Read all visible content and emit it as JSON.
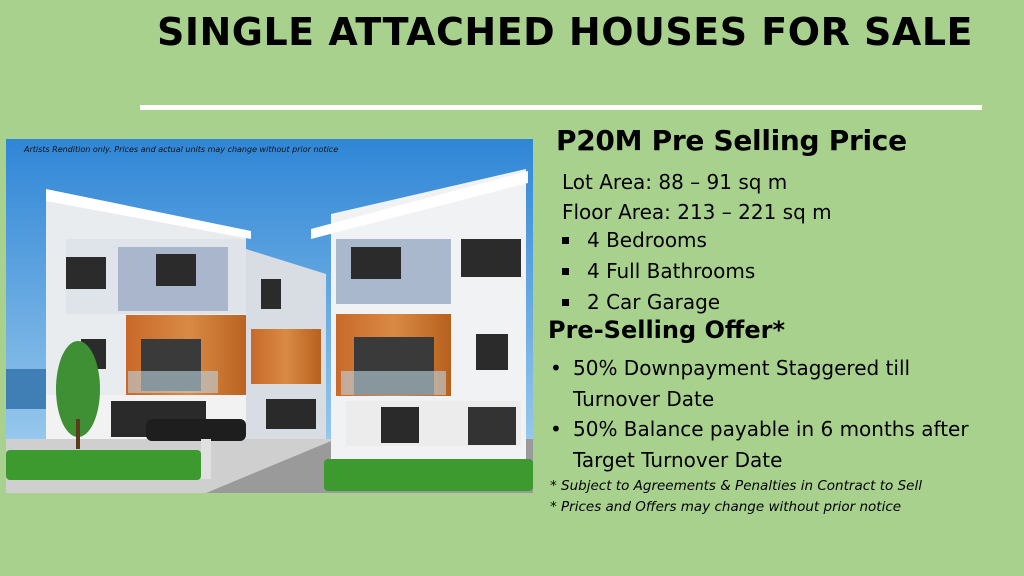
{
  "title": "SINGLE ATTACHED HOUSES FOR SALE",
  "image": {
    "disclaimer": "Artists Rendition only. Prices and actual units may change without prior notice"
  },
  "listing": {
    "price": "P20M  Pre Selling Price",
    "lot_area": "Lot Area: 88 – 91 sq m",
    "floor_area": "Floor Area: 213 – 221 sq m",
    "features": [
      "4 Bedrooms",
      "4 Full Bathrooms",
      "2 Car Garage"
    ]
  },
  "offer": {
    "heading": "Pre-Selling Offer*",
    "bullets": [
      {
        "line1": "50% Downpayment Staggered till",
        "line2": "Turnover Date"
      },
      {
        "line1": "50% Balance payable in 6 months after",
        "line2": "Target Turnover Date"
      }
    ],
    "notes": [
      "* Subject to Agreements & Penalties in Contract to Sell",
      "* Prices and Offers may change without prior notice"
    ]
  }
}
